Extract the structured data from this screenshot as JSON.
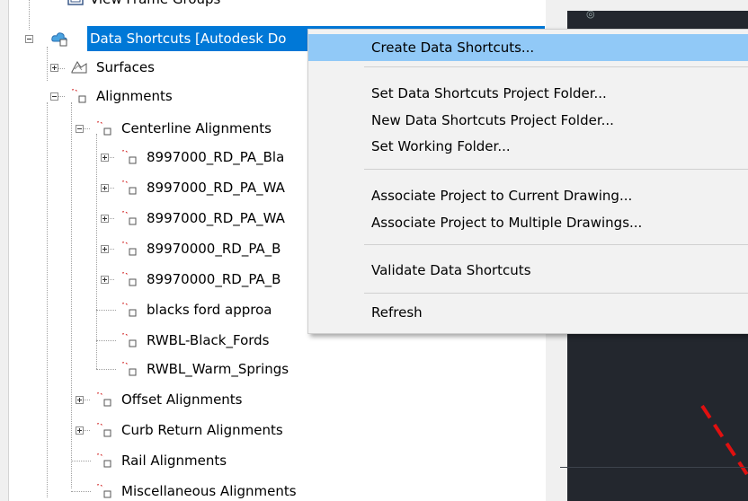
{
  "tree": {
    "view_frame_groups": "View Frame Groups",
    "data_shortcuts": "Data Shortcuts [Autodesk Do",
    "surfaces": "Surfaces",
    "alignments": "Alignments",
    "centerline_alignments": "Centerline Alignments",
    "items": [
      "8997000_RD_PA_Bla",
      "8997000_RD_PA_WA",
      "8997000_RD_PA_WA",
      "89970000_RD_PA_B",
      "89970000_RD_PA_B",
      "blacks ford approa",
      "RWBL-Black_Fords",
      "RWBL_Warm_Springs"
    ],
    "offset_alignments": "Offset Alignments",
    "curb_return_alignments": "Curb Return Alignments",
    "rail_alignments": "Rail Alignments",
    "misc_alignments": "Miscellaneous Alignments"
  },
  "menu": {
    "create": "Create Data Shortcuts...",
    "set_project_folder": "Set Data Shortcuts Project Folder...",
    "new_project_folder": "New Data Shortcuts Project Folder...",
    "set_working_folder": "Set Working Folder...",
    "associate_current": "Associate Project to Current Drawing...",
    "associate_multiple": "Associate Project to Multiple Drawings...",
    "validate": "Validate Data Shortcuts",
    "refresh": "Refresh"
  },
  "colors": {
    "selection": "#0078d7",
    "menu_highlight": "#91c9f7",
    "cad_background": "#23272e",
    "cad_dash": "#e01010"
  },
  "icons": {
    "cloud": "data-shortcuts-cloud-icon",
    "surface": "surface-icon",
    "alignment": "alignment-icon",
    "view_frame": "view-frame-group-icon"
  }
}
